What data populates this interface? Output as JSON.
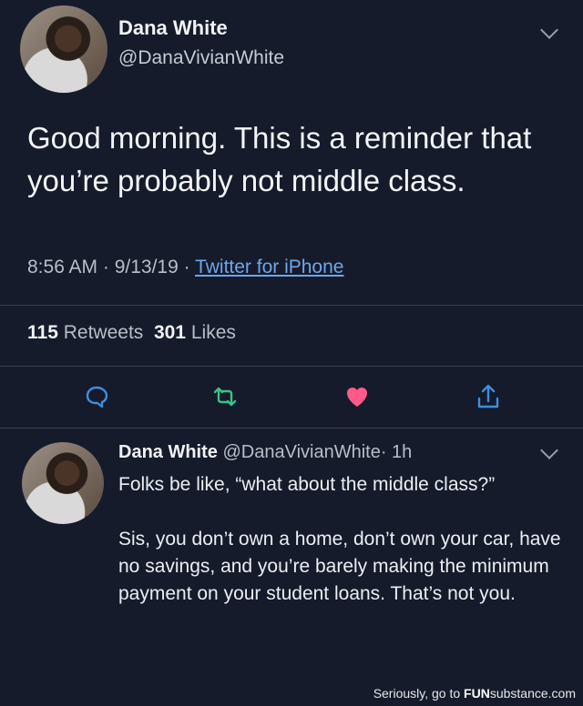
{
  "tweet": {
    "author_name": "Dana White",
    "author_handle": "@DanaVivianWhite",
    "text": "Good morning. This is a reminder that you’re probably not middle class.",
    "time": "8:56 AM · 9/13/19 · ",
    "source": "Twitter for iPhone",
    "retweets_count": "115",
    "retweets_label": "Retweets",
    "likes_count": "301",
    "likes_label": "Likes",
    "like_color": "#ff5a8a",
    "retweet_color": "#3cc18a"
  },
  "reply": {
    "author_name": "Dana White",
    "author_handle": "@DanaVivianWhite",
    "time": "· 1h",
    "text": "Folks be like, “what about the middle class?”\n\nSis, you don’t own a home, don’t own your car, have no savings, and you’re barely making the minimum payment on your student loans. That’s not you."
  },
  "watermark": {
    "prefix": "Seriously, go to ",
    "brand_a": "FUN",
    "brand_b": "substance",
    "suffix": ".com"
  }
}
